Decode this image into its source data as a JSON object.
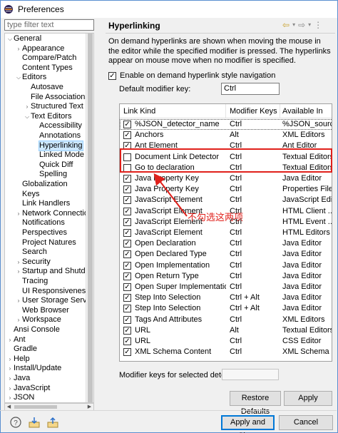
{
  "window": {
    "title": "Preferences"
  },
  "sidebar": {
    "filter_placeholder": "type filter text",
    "items": [
      {
        "label": "General",
        "toggle": "⌵",
        "level": 0
      },
      {
        "label": "Appearance",
        "toggle": "›",
        "level": 1
      },
      {
        "label": "Compare/Patch",
        "toggle": "",
        "level": 1
      },
      {
        "label": "Content Types",
        "toggle": "",
        "level": 1
      },
      {
        "label": "Editors",
        "toggle": "⌵",
        "level": 1
      },
      {
        "label": "Autosave",
        "toggle": "",
        "level": 2
      },
      {
        "label": "File Associations",
        "toggle": "",
        "level": 2
      },
      {
        "label": "Structured Text Ed",
        "toggle": "›",
        "level": 2
      },
      {
        "label": "Text Editors",
        "toggle": "⌵",
        "level": 2
      },
      {
        "label": "Accessibility",
        "toggle": "",
        "level": 3
      },
      {
        "label": "Annotations",
        "toggle": "",
        "level": 3
      },
      {
        "label": "Hyperlinking",
        "toggle": "",
        "level": 3,
        "selected": true
      },
      {
        "label": "Linked Mode",
        "toggle": "",
        "level": 3
      },
      {
        "label": "Quick Diff",
        "toggle": "",
        "level": 3
      },
      {
        "label": "Spelling",
        "toggle": "",
        "level": 3
      },
      {
        "label": "Globalization",
        "toggle": "",
        "level": 1
      },
      {
        "label": "Keys",
        "toggle": "",
        "level": 1
      },
      {
        "label": "Link Handlers",
        "toggle": "",
        "level": 1
      },
      {
        "label": "Network Connections",
        "toggle": "›",
        "level": 1
      },
      {
        "label": "Notifications",
        "toggle": "",
        "level": 1
      },
      {
        "label": "Perspectives",
        "toggle": "",
        "level": 1
      },
      {
        "label": "Project Natures",
        "toggle": "",
        "level": 1
      },
      {
        "label": "Search",
        "toggle": "",
        "level": 1
      },
      {
        "label": "Security",
        "toggle": "›",
        "level": 1
      },
      {
        "label": "Startup and Shutdown",
        "toggle": "›",
        "level": 1
      },
      {
        "label": "Tracing",
        "toggle": "",
        "level": 1
      },
      {
        "label": "UI Responsiveness Mo",
        "toggle": "",
        "level": 1
      },
      {
        "label": "User Storage Service",
        "toggle": "›",
        "level": 1
      },
      {
        "label": "Web Browser",
        "toggle": "",
        "level": 1
      },
      {
        "label": "Workspace",
        "toggle": "›",
        "level": 1
      },
      {
        "label": "Ansi Console",
        "toggle": "",
        "level": 0
      },
      {
        "label": "Ant",
        "toggle": "›",
        "level": 0
      },
      {
        "label": "Gradle",
        "toggle": "",
        "level": 0
      },
      {
        "label": "Help",
        "toggle": "›",
        "level": 0
      },
      {
        "label": "Install/Update",
        "toggle": "›",
        "level": 0
      },
      {
        "label": "Java",
        "toggle": "›",
        "level": 0
      },
      {
        "label": "JavaScript",
        "toggle": "›",
        "level": 0
      },
      {
        "label": "JSON",
        "toggle": "›",
        "level": 0
      }
    ]
  },
  "panel": {
    "title": "Hyperlinking",
    "description": "On demand hyperlinks are shown when moving the mouse in the editor while the specified modifier is pressed. The hyperlinks appear on mouse move when no modifier is specified.",
    "enable_label": "Enable on demand hyperlink style navigation",
    "enable_checked": "✓",
    "default_modifier_label": "Default modifier key:",
    "default_modifier_value": "Ctrl",
    "table": {
      "headers": [
        "Link Kind",
        "Modifier Keys",
        "Available In"
      ],
      "rows": [
        {
          "checked": "✓",
          "kind": "%JSON_detector_name",
          "mod": "Ctrl",
          "avail": "%JSON_sourc..."
        },
        {
          "checked": "✓",
          "kind": "Anchors",
          "mod": "Alt",
          "avail": "XML Editors"
        },
        {
          "checked": "✓",
          "kind": "Ant Element",
          "mod": "Ctrl",
          "avail": "Ant Editor"
        },
        {
          "checked": "",
          "kind": "Document Link Detector",
          "mod": "Ctrl",
          "avail": "Textual Editors"
        },
        {
          "checked": "",
          "kind": "Go to declaration",
          "mod": "Ctrl",
          "avail": "Textual Editors"
        },
        {
          "checked": "✓",
          "kind": "Java Property Key",
          "mod": "Ctrl",
          "avail": "Java Editor"
        },
        {
          "checked": "✓",
          "kind": "Java Property Key",
          "mod": "Ctrl",
          "avail": "Properties File..."
        },
        {
          "checked": "✓",
          "kind": "JavaScript Element",
          "mod": "Ctrl",
          "avail": "JavaScript Editor"
        },
        {
          "checked": "✓",
          "kind": "JavaScript Element",
          "mod": "Ctrl",
          "avail": "HTML Client ..."
        },
        {
          "checked": "✓",
          "kind": "JavaScript Element",
          "mod": "Ctrl",
          "avail": "HTML Event ..."
        },
        {
          "checked": "✓",
          "kind": "JavaScript Element",
          "mod": "Ctrl",
          "avail": "HTML Editors"
        },
        {
          "checked": "✓",
          "kind": "Open Declaration",
          "mod": "Ctrl",
          "avail": "Java Editor"
        },
        {
          "checked": "✓",
          "kind": "Open Declared Type",
          "mod": "Ctrl",
          "avail": "Java Editor"
        },
        {
          "checked": "✓",
          "kind": "Open Implementation",
          "mod": "Ctrl",
          "avail": "Java Editor"
        },
        {
          "checked": "✓",
          "kind": "Open Return Type",
          "mod": "Ctrl",
          "avail": "Java Editor"
        },
        {
          "checked": "✓",
          "kind": "Open Super Implementation",
          "mod": "Ctrl",
          "avail": "Java Editor"
        },
        {
          "checked": "✓",
          "kind": "Step Into Selection",
          "mod": "Ctrl + Alt",
          "avail": "Java Editor"
        },
        {
          "checked": "✓",
          "kind": "Step Into Selection",
          "mod": "Ctrl + Alt",
          "avail": "Java Editor"
        },
        {
          "checked": "✓",
          "kind": "Tags And Attributes",
          "mod": "Ctrl",
          "avail": "XML Editors"
        },
        {
          "checked": "✓",
          "kind": "URL",
          "mod": "Alt",
          "avail": "Textual Editors"
        },
        {
          "checked": "✓",
          "kind": "URL",
          "mod": "Ctrl",
          "avail": "CSS Editor"
        },
        {
          "checked": "✓",
          "kind": "XML Schema Content",
          "mod": "Ctrl",
          "avail": "XML Schema ..."
        }
      ]
    },
    "selected_modifier_label": "Modifier keys for selected detector:",
    "annotation": "不勾选这两项",
    "restore_defaults_label": "Restore Defaults",
    "apply_label": "Apply"
  },
  "footer": {
    "apply_close_label": "Apply and Close",
    "cancel_label": "Cancel"
  },
  "colors": {
    "accent": "#0078d7",
    "annotation": "#e0201b",
    "selection": "#cce8ff"
  }
}
